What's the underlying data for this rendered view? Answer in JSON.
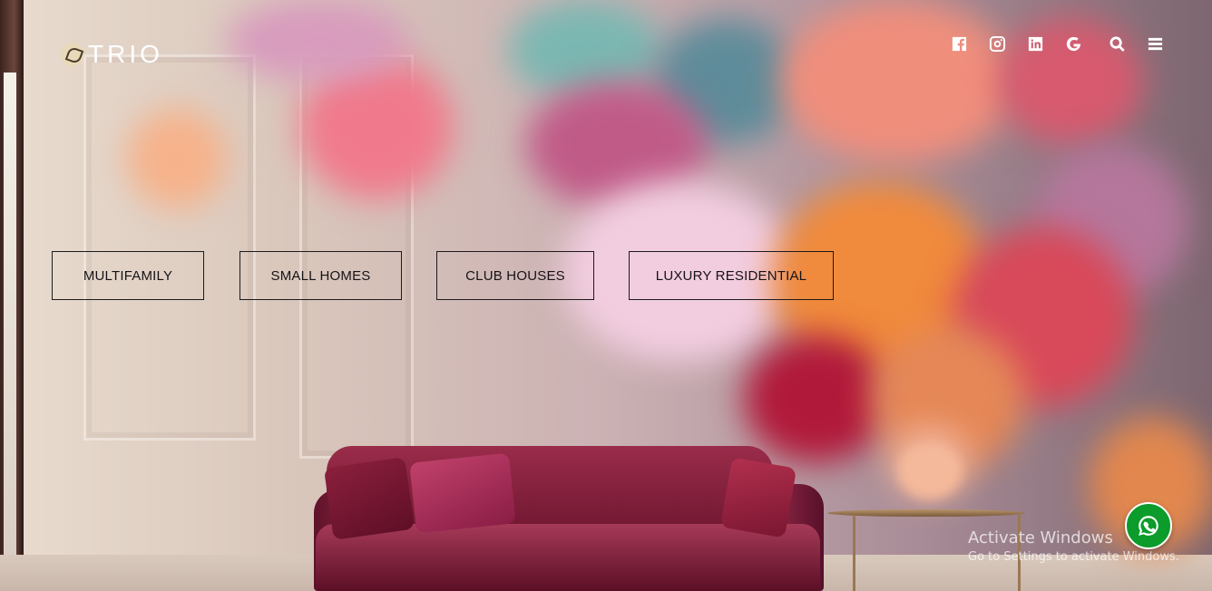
{
  "header": {
    "logo_text": "TRIO",
    "icons": [
      "facebook-icon",
      "instagram-icon",
      "linkedin-icon",
      "google-icon",
      "search-icon",
      "menu-icon"
    ]
  },
  "categories": [
    {
      "label": "MULTIFAMILY"
    },
    {
      "label": "SMALL HOMES"
    },
    {
      "label": "CLUB HOUSES"
    },
    {
      "label": "LUXURY RESIDENTIAL"
    }
  ],
  "watermark": {
    "title": "Activate Windows",
    "subtitle": "Go to Settings to activate Windows."
  },
  "whatsapp": {
    "icon": "whatsapp-icon",
    "color": "#0b9c2b"
  }
}
